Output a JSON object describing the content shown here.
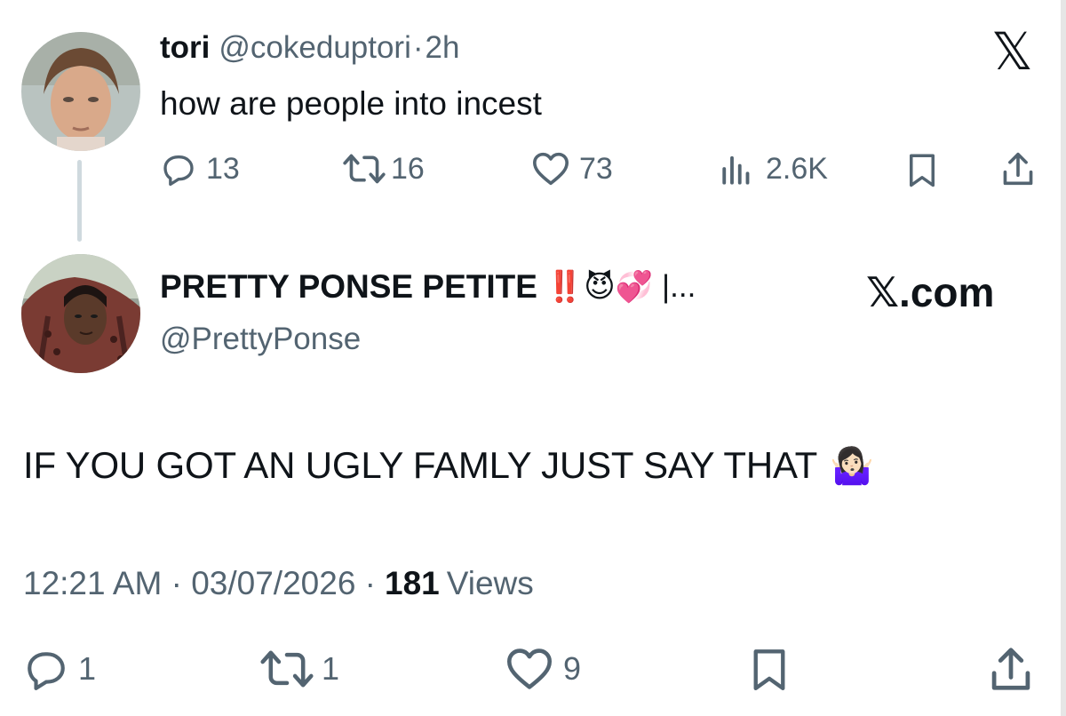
{
  "original_tweet": {
    "name": "tori",
    "handle": "@cokeduptori",
    "separator": "·",
    "time": "2h",
    "text": "how are people into incest",
    "actions": {
      "replies": "13",
      "retweets": "16",
      "likes": "73",
      "views": "2.6K"
    },
    "logo": "𝕏"
  },
  "quote_tweet": {
    "name": "PRETTY PONSE PETITE",
    "name_emoji": "‼️😈💞",
    "name_suffix": "|...",
    "handle": "@PrettyPonse",
    "brand": "𝕏.com",
    "text": "IF YOU GOT AN UGLY FAMLY JUST SAY THAT",
    "text_emoji": "🤷🏻‍♀️",
    "timestamp": "12:21 AM · 03/07/2026 ·",
    "views_count": "181",
    "views_label": "Views",
    "actions": {
      "replies": "1",
      "retweets": "1",
      "likes": "9"
    }
  },
  "icons": {
    "reply": "reply-icon",
    "retweet": "retweet-icon",
    "like": "heart-icon",
    "views": "views-icon",
    "bookmark": "bookmark-icon",
    "share": "share-icon"
  },
  "colors": {
    "text": "#0f1419",
    "muted": "#536471",
    "thread_line": "#cfd9de"
  }
}
